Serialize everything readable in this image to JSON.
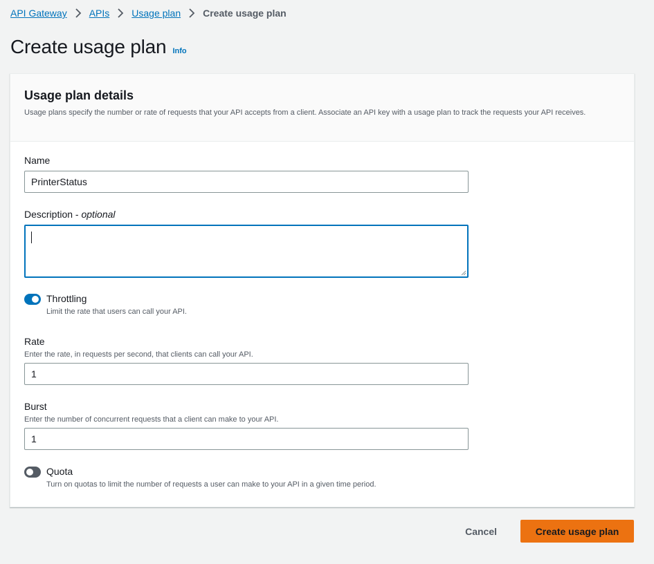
{
  "breadcrumb": {
    "items": [
      {
        "label": "API Gateway"
      },
      {
        "label": "APIs"
      },
      {
        "label": "Usage plan"
      },
      {
        "label": "Create usage plan"
      }
    ]
  },
  "page": {
    "title": "Create usage plan",
    "info_label": "Info"
  },
  "panel": {
    "title": "Usage plan details",
    "description": "Usage plans specify the number or rate of requests that your API accepts from a client. Associate an API key with a usage plan to track the requests your API receives."
  },
  "form": {
    "name": {
      "label": "Name",
      "value": "PrinterStatus"
    },
    "description": {
      "label": "Description",
      "optional_suffix": "optional",
      "value": ""
    },
    "throttling": {
      "label": "Throttling",
      "desc": "Limit the rate that users can call your API.",
      "enabled": true
    },
    "rate": {
      "label": "Rate",
      "hint": "Enter the rate, in requests per second, that clients can call your API.",
      "value": "1"
    },
    "burst": {
      "label": "Burst",
      "hint": "Enter the number of concurrent requests that a client can make to your API.",
      "value": "1"
    },
    "quota": {
      "label": "Quota",
      "desc": "Turn on quotas to limit the number of requests a user can make to your API in a given time period.",
      "enabled": false
    }
  },
  "actions": {
    "cancel_label": "Cancel",
    "submit_label": "Create usage plan"
  },
  "colors": {
    "link": "#0073bb",
    "primary_button": "#ec7211",
    "toggle_on": "#0073bb",
    "toggle_off": "#545b64",
    "page_background": "#f2f3f3"
  },
  "icons": {
    "breadcrumb_separator": "chevron-right-icon",
    "textarea_resize": "resize-grip-icon"
  }
}
